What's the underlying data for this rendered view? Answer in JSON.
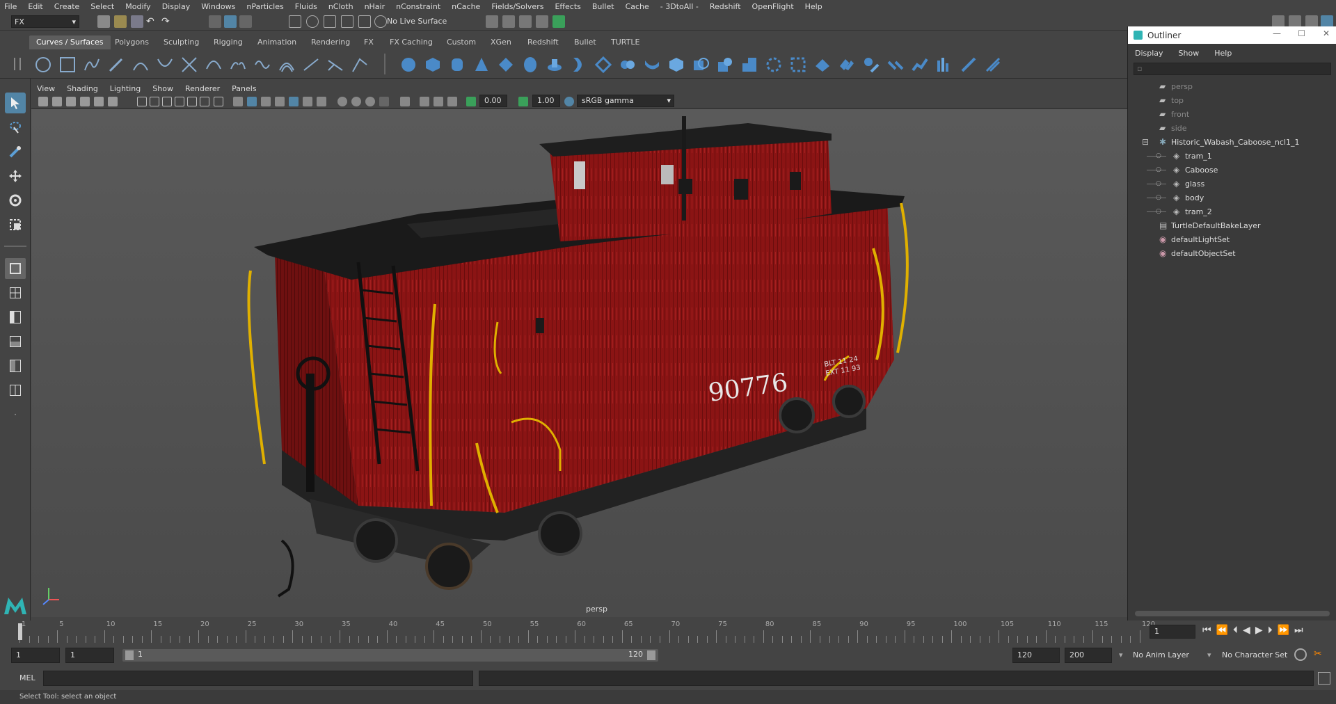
{
  "menubar": {
    "items": [
      "File",
      "Edit",
      "Create",
      "Select",
      "Modify",
      "Display",
      "Windows",
      "nParticles",
      "Fluids",
      "nCloth",
      "nHair",
      "nConstraint",
      "nCache",
      "Fields/Solvers",
      "Effects",
      "Bullet",
      "Cache",
      "- 3DtoAll -",
      "Redshift",
      "OpenFlight",
      "Help"
    ]
  },
  "statusline": {
    "mode_combo": "FX",
    "live_surface": "No Live Surface"
  },
  "shelf": {
    "tabs": [
      "Curves / Surfaces",
      "Polygons",
      "Sculpting",
      "Rigging",
      "Animation",
      "Rendering",
      "FX",
      "FX Caching",
      "Custom",
      "XGen",
      "Redshift",
      "Bullet",
      "TURTLE"
    ],
    "active_tab": "Curves / Surfaces"
  },
  "viewport": {
    "menu": [
      "View",
      "Shading",
      "Lighting",
      "Show",
      "Renderer",
      "Panels"
    ],
    "exposure": "0.00",
    "gamma": "1.00",
    "colorspace": "sRGB gamma",
    "camera_label": "persp",
    "car_number": "90776",
    "car_text_1": "BLT 11 24",
    "car_text_2": "EXT 11 93"
  },
  "outliner": {
    "title": "Outliner",
    "menu": [
      "Display",
      "Show",
      "Help"
    ],
    "items": [
      {
        "label": "persp",
        "type": "camera",
        "dim": true,
        "indent": 0
      },
      {
        "label": "top",
        "type": "camera",
        "dim": true,
        "indent": 0
      },
      {
        "label": "front",
        "type": "camera",
        "dim": true,
        "indent": 0
      },
      {
        "label": "side",
        "type": "camera",
        "dim": true,
        "indent": 0
      },
      {
        "label": "Historic_Wabash_Caboose_ncl1_1",
        "type": "group",
        "dim": false,
        "indent": 0
      },
      {
        "label": "tram_1",
        "type": "mesh",
        "dim": false,
        "indent": 1
      },
      {
        "label": "Caboose",
        "type": "mesh",
        "dim": false,
        "indent": 1
      },
      {
        "label": "glass",
        "type": "mesh",
        "dim": false,
        "indent": 1
      },
      {
        "label": "body",
        "type": "mesh",
        "dim": false,
        "indent": 1
      },
      {
        "label": "tram_2",
        "type": "mesh",
        "dim": false,
        "indent": 1
      },
      {
        "label": "TurtleDefaultBakeLayer",
        "type": "layer",
        "dim": false,
        "indent": 0
      },
      {
        "label": "defaultLightSet",
        "type": "set",
        "dim": false,
        "indent": 0
      },
      {
        "label": "defaultObjectSet",
        "type": "set",
        "dim": false,
        "indent": 0
      }
    ]
  },
  "timeline": {
    "ticks": [
      "1",
      "5",
      "10",
      "15",
      "20",
      "25",
      "30",
      "35",
      "40",
      "45",
      "50",
      "55",
      "60",
      "65",
      "70",
      "75",
      "80",
      "85",
      "90",
      "95",
      "100",
      "105",
      "110",
      "115",
      "120"
    ],
    "current_frame": "1"
  },
  "range": {
    "start": "1",
    "playback_start": "1",
    "slider_start": "1",
    "slider_end": "120",
    "playback_end": "120",
    "end": "200",
    "anim_layer": "No Anim Layer",
    "char_set": "No Character Set"
  },
  "mel": {
    "label": "MEL"
  },
  "help": {
    "text": "Select Tool: select an object"
  },
  "colors": {
    "accent": "#5285a6",
    "caboose_red": "#8b1414",
    "handrail": "#e0b000"
  }
}
